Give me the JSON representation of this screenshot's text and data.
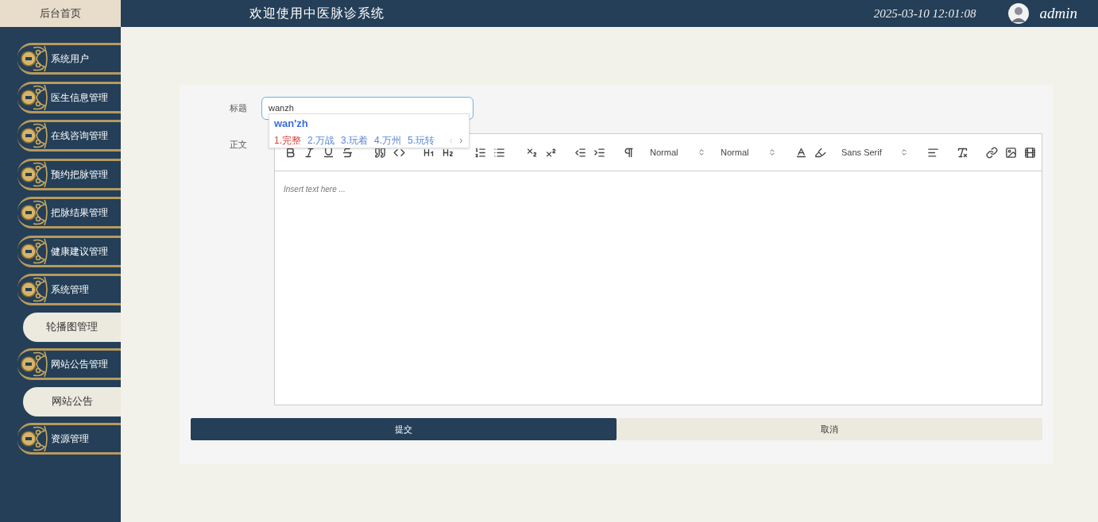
{
  "header": {
    "home": "后台首页",
    "title": "欢迎使用中医脉诊系统",
    "datetime": "2025-03-10 12:01:08",
    "user": "admin"
  },
  "sidebar": {
    "items": [
      {
        "label": "系统用户",
        "kind": "ornate"
      },
      {
        "label": "医生信息管理",
        "kind": "ornate"
      },
      {
        "label": "在线咨询管理",
        "kind": "ornate"
      },
      {
        "label": "预约把脉管理",
        "kind": "ornate"
      },
      {
        "label": "把脉结果管理",
        "kind": "ornate"
      },
      {
        "label": "健康建议管理",
        "kind": "ornate"
      },
      {
        "label": "系统管理",
        "kind": "ornate"
      },
      {
        "label": "轮播图管理",
        "kind": "pill"
      },
      {
        "label": "网站公告管理",
        "kind": "ornate"
      },
      {
        "label": "网站公告",
        "kind": "pill"
      },
      {
        "label": "资源管理",
        "kind": "ornate"
      }
    ]
  },
  "form": {
    "title_label": "标题",
    "title_value": "wanzh",
    "ime": {
      "composition": "wan'zh",
      "candidates": [
        {
          "label": "1.完整",
          "selected": true
        },
        {
          "label": "2.万战",
          "selected": false
        },
        {
          "label": "3.玩着",
          "selected": false
        },
        {
          "label": "4.万州",
          "selected": false
        },
        {
          "label": "5.玩转",
          "selected": false
        }
      ]
    },
    "body_label": "正文",
    "pickers": [
      "Normal",
      "Normal",
      "Sans Serif"
    ],
    "editor_placeholder": "Insert text here ...",
    "submit": "提交",
    "cancel": "取消"
  }
}
